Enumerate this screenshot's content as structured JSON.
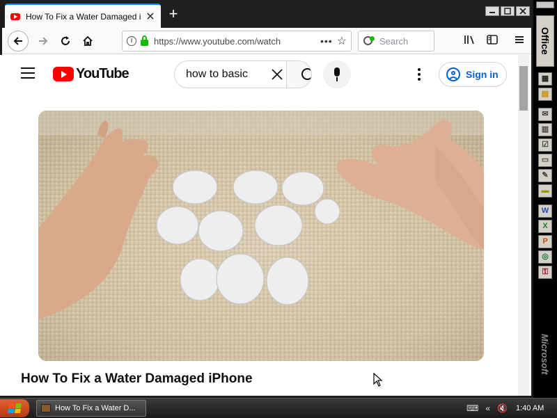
{
  "browser": {
    "tab_title": "How To Fix a Water Damaged iPhone",
    "tab_close": "✕",
    "new_tab": "+",
    "url": "https://www.youtube.com/watch",
    "url_more": "•••",
    "search_placeholder": "Search"
  },
  "youtube": {
    "logo_text": "YouTube",
    "search_value": "how to basic",
    "signin_label": "Sign in",
    "video_title": "How To Fix a Water Damaged iPhone"
  },
  "office_bar": {
    "label": "Office",
    "brand": "Microsoft"
  },
  "taskbar": {
    "task_label": "How To Fix a Water D...",
    "tray_arrows": "«",
    "clock": "1:40 AM"
  },
  "colors": {
    "youtube_red": "#ff0000",
    "link_blue": "#065fd4",
    "firefox_focus": "#0a84ff",
    "secure_green": "#12bc00"
  },
  "icons": [
    "back-arrow-icon",
    "forward-arrow-icon",
    "reload-icon",
    "home-icon",
    "info-icon",
    "lock-icon",
    "star-icon",
    "library-icon",
    "sidebar-icon",
    "menu-icon",
    "hamburger-icon",
    "clear-icon",
    "search-icon",
    "microphone-icon",
    "more-vertical-icon",
    "account-icon",
    "windows-logo-icon",
    "cursor-icon"
  ]
}
